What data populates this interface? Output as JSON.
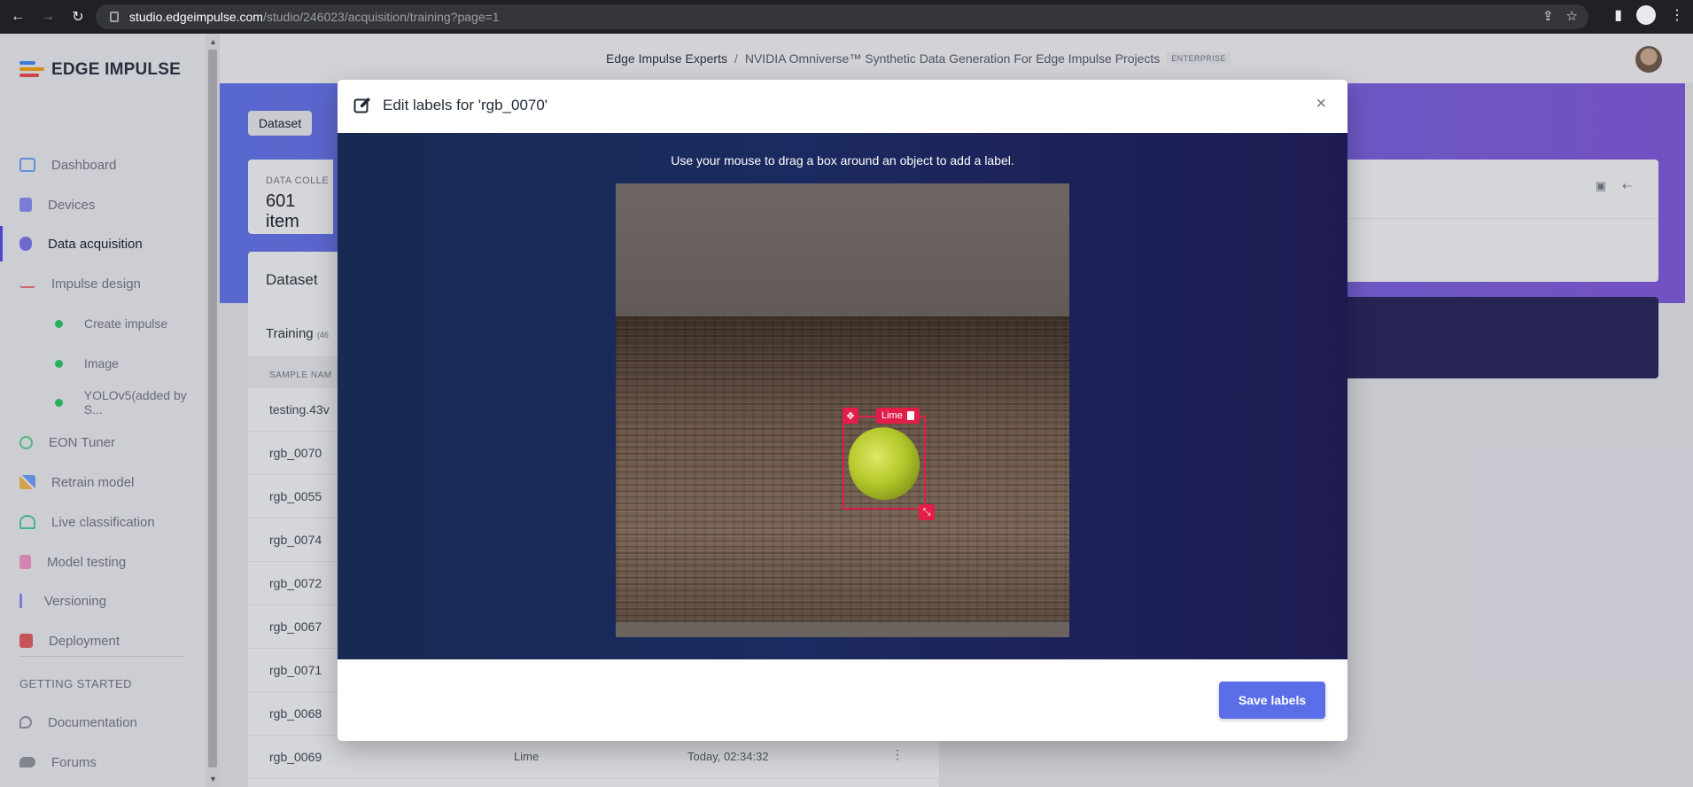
{
  "browser": {
    "url_host": "studio.edgeimpulse.com",
    "url_path": "/studio/246023/acquisition/training?page=1"
  },
  "sidebar": {
    "brand": "EDGE IMPULSE",
    "items": [
      {
        "label": "Dashboard",
        "icon": "monitor-icon"
      },
      {
        "label": "Devices",
        "icon": "chip-icon"
      },
      {
        "label": "Data acquisition",
        "icon": "database-icon"
      },
      {
        "label": "Impulse design",
        "icon": "pulse-icon"
      },
      {
        "label": "Create impulse"
      },
      {
        "label": "Image"
      },
      {
        "label": "YOLOv5(added by S..."
      },
      {
        "label": "EON Tuner",
        "icon": "compass-icon"
      },
      {
        "label": "Retrain model",
        "icon": "shuffle-icon"
      },
      {
        "label": "Live classification",
        "icon": "network-icon"
      },
      {
        "label": "Model testing",
        "icon": "clipboard-icon"
      },
      {
        "label": "Versioning",
        "icon": "branch-icon"
      },
      {
        "label": "Deployment",
        "icon": "box-icon"
      }
    ],
    "section": "GETTING STARTED",
    "getting_started": [
      {
        "label": "Documentation",
        "icon": "rocket-icon"
      },
      {
        "label": "Forums",
        "icon": "chat-icon"
      }
    ]
  },
  "header": {
    "org": "Edge Impulse Experts",
    "separator": "/",
    "project": "NVIDIA Omniverse™ Synthetic Data Generation For Edge Impulse Projects",
    "badge": "ENTERPRISE"
  },
  "page": {
    "tab": "Dataset",
    "collect_label": "DATA COLLE",
    "collect_value": "601 item",
    "panel_title": "Dataset",
    "training_label": "Training",
    "training_count": "(46",
    "column_header": "SAMPLE NAM",
    "rows": [
      {
        "name": "testing.43v",
        "label": "",
        "date": ""
      },
      {
        "name": "rgb_0070",
        "label": "",
        "date": ""
      },
      {
        "name": "rgb_0055",
        "label": "",
        "date": ""
      },
      {
        "name": "rgb_0074",
        "label": "",
        "date": ""
      },
      {
        "name": "rgb_0072",
        "label": "",
        "date": ""
      },
      {
        "name": "rgb_0067",
        "label": "",
        "date": ""
      },
      {
        "name": "rgb_0071",
        "label": "",
        "date": ""
      },
      {
        "name": "rgb_0068",
        "label": "",
        "date": ""
      },
      {
        "name": "rgb_0069",
        "label": "Lime",
        "date": "Today, 02:34:32"
      }
    ]
  },
  "modal": {
    "title": "Edit labels for 'rgb_0070'",
    "close": "×",
    "instructions": "Use your mouse to drag a box around an object to add a label.",
    "box_label": "Lime",
    "save_button": "Save labels"
  },
  "colors": {
    "accent": "#5b6ee8",
    "bbox": "#e11d48",
    "active_nav": "#4f46e5"
  }
}
